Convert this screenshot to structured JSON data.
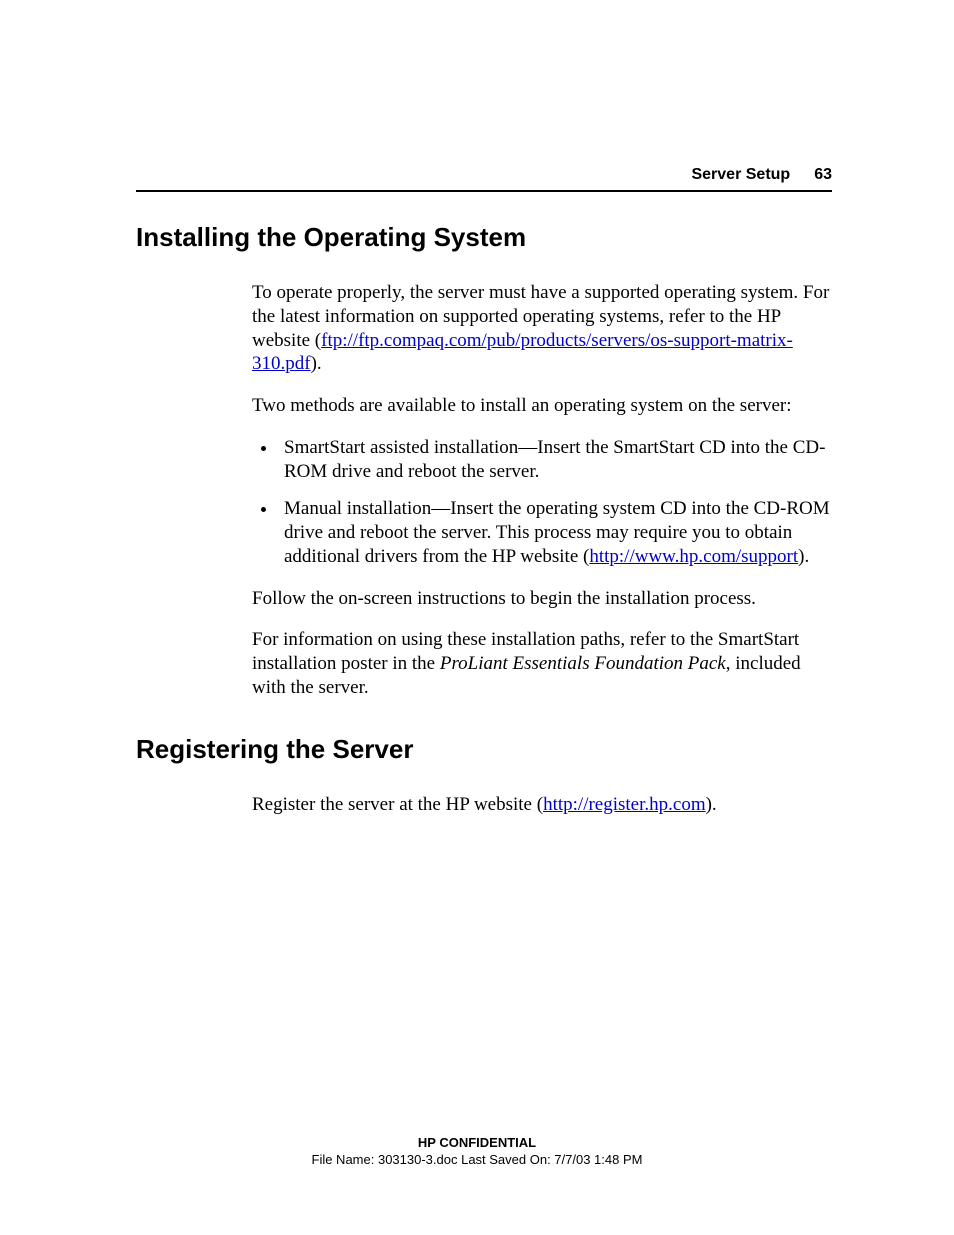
{
  "header": {
    "section": "Server Setup",
    "page_number": "63"
  },
  "section1": {
    "heading": "Installing the Operating System",
    "p1_a": "To operate properly, the server must have a supported operating system. For the latest information on supported operating systems, refer to the HP website (",
    "p1_link": "ftp://ftp.compaq.com/pub/products/servers/os-support-matrix-310.pdf",
    "p1_b": ").",
    "p2": "Two methods are available to install an operating system on the server:",
    "bullets": {
      "b1": "SmartStart assisted installation—Insert the SmartStart CD into the CD-ROM drive and reboot the server.",
      "b2_a": "Manual installation—Insert the operating system CD into the CD-ROM drive and reboot the server. This process may require you to obtain additional drivers from the HP website (",
      "b2_link": "http://www.hp.com/support",
      "b2_b": ")."
    },
    "p3": "Follow the on-screen instructions to begin the installation process.",
    "p4_a": "For information on using these installation paths, refer to the SmartStart installation poster in the ",
    "p4_italic": "ProLiant Essentials Foundation Pack",
    "p4_b": ", included with the server."
  },
  "section2": {
    "heading": "Registering the Server",
    "p1_a": "Register the server at the HP website (",
    "p1_link": "http://register.hp.com",
    "p1_b": ")."
  },
  "footer": {
    "confidential": "HP CONFIDENTIAL",
    "meta": "File Name: 303130-3.doc   Last Saved On: 7/7/03 1:48 PM"
  }
}
